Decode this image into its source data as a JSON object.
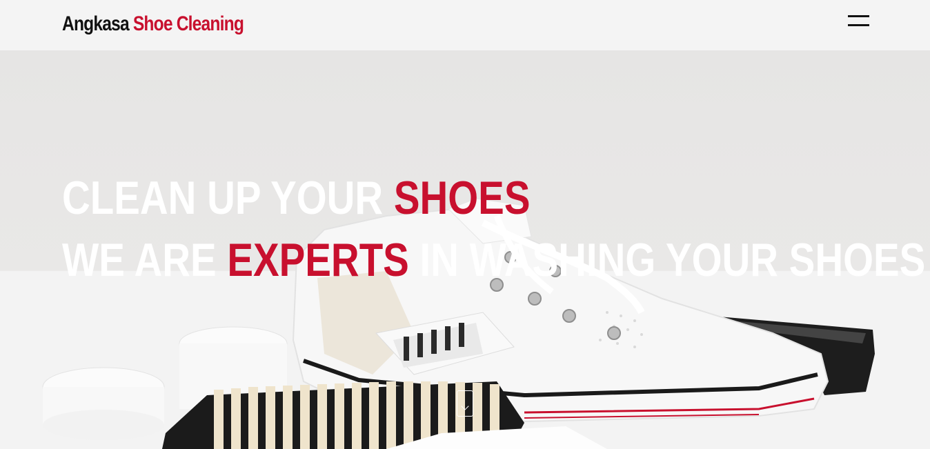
{
  "navbar": {
    "brand_primary": "Angkasa",
    "brand_accent": "Shoe Cleaning",
    "menu_icon": "hamburger-menu-icon"
  },
  "hero": {
    "line1_part1": "CLEAN UP YOUR ",
    "line1_highlight": "SHOES",
    "line2_part1": "WE ARE ",
    "line2_highlight": "EXPERTS",
    "line2_part2": " IN WASHING YOUR SHOES",
    "background_image": "white sneaker with cleaning brushes",
    "scroll_icon": "chevron-down-icon"
  },
  "colors": {
    "accent": "#c8102e",
    "text_dark": "#111111",
    "navbar_bg": "#f4f4f4",
    "hero_text": "#ffffff"
  }
}
